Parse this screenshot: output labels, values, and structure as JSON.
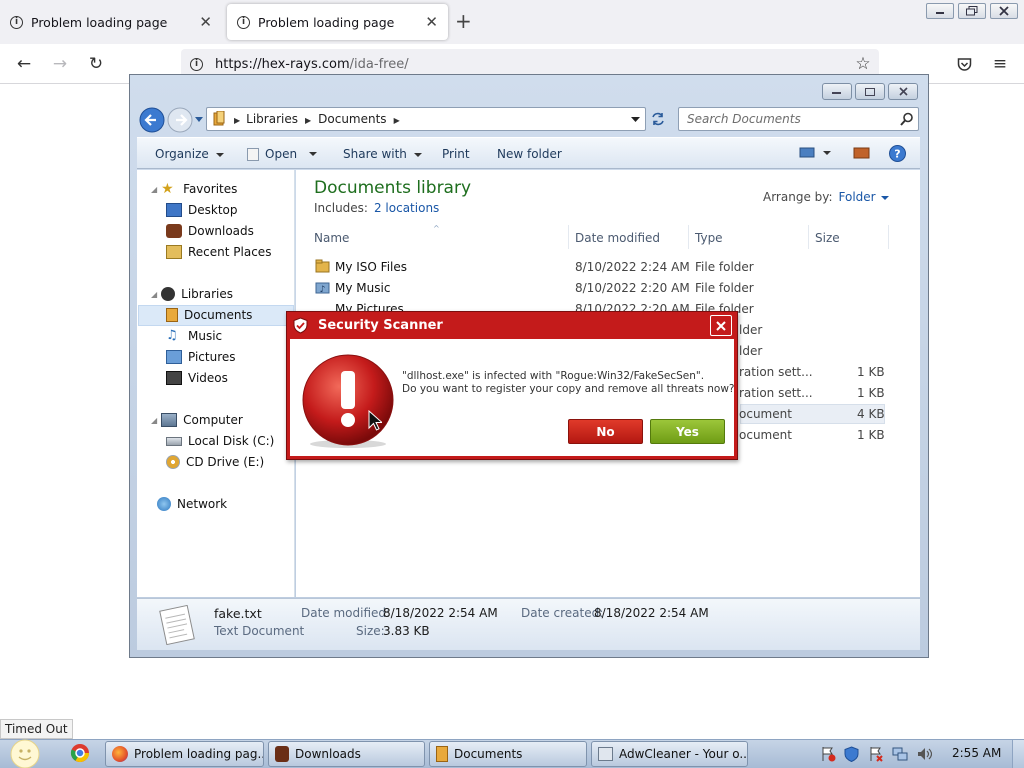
{
  "browser": {
    "tabs": [
      {
        "title": "Problem loading page"
      },
      {
        "title": "Problem loading page"
      }
    ],
    "url_host": "https://hex-rays.com",
    "url_path": "/ida-free/",
    "status_text": "Timed Out"
  },
  "explorer": {
    "breadcrumb": [
      "Libraries",
      "Documents"
    ],
    "search_placeholder": "Search Documents",
    "toolbar": {
      "organize": "Organize",
      "open": "Open",
      "share_with": "Share with",
      "print": "Print",
      "new_folder": "New folder"
    },
    "nav": {
      "favorites": "Favorites",
      "favorites_items": [
        "Desktop",
        "Downloads",
        "Recent Places"
      ],
      "libraries": "Libraries",
      "libraries_items": [
        "Documents",
        "Music",
        "Pictures",
        "Videos"
      ],
      "computer": "Computer",
      "computer_items": [
        "Local Disk (C:)",
        "CD Drive (E:)"
      ],
      "network": "Network"
    },
    "library": {
      "title": "Documents library",
      "includes_label": "Includes:",
      "includes_link": "2 locations",
      "arrange_label": "Arrange by:",
      "arrange_value": "Folder"
    },
    "columns": {
      "name": "Name",
      "date": "Date modified",
      "type": "Type",
      "size": "Size"
    },
    "files": [
      {
        "name": "My ISO Files",
        "date": "8/10/2022 2:24 AM",
        "type": "File folder",
        "size": ""
      },
      {
        "name": "My Music",
        "date": "8/10/2022 2:20 AM",
        "type": "File folder",
        "size": ""
      },
      {
        "name": "My Pictures",
        "date": "8/10/2022 2:20 AM",
        "type": "File folder",
        "size": ""
      },
      {
        "name": "",
        "date": "",
        "type": "lder",
        "size": ""
      },
      {
        "name": "",
        "date": "",
        "type": "lder",
        "size": ""
      },
      {
        "name": "",
        "date": "",
        "type": "ration sett...",
        "size": "1 KB"
      },
      {
        "name": "",
        "date": "",
        "type": "ration sett...",
        "size": "1 KB"
      },
      {
        "name": "",
        "date": "",
        "type": "ocument",
        "size": "4 KB"
      },
      {
        "name": "",
        "date": "",
        "type": "ocument",
        "size": "1 KB"
      }
    ],
    "details": {
      "file_name": "fake.txt",
      "file_type": "Text Document",
      "modified_label": "Date modified:",
      "modified_value": "8/18/2022 2:54 AM",
      "created_label": "Date created:",
      "created_value": "8/18/2022 2:54 AM",
      "size_label": "Size:",
      "size_value": "3.83 KB"
    }
  },
  "dialog": {
    "title": "Security Scanner",
    "message_line1": "\"dllhost.exe\" is infected with \"Rogue:Win32/FakeSecSen\".",
    "message_line2": "Do you want to register your copy and remove all threats now?",
    "no_label": "No",
    "yes_label": "Yes"
  },
  "taskbar": {
    "buttons": [
      "Problem loading pag...",
      "Downloads",
      "Documents",
      "AdwCleaner - Your o..."
    ],
    "clock": "2:55 AM"
  },
  "colors": {
    "dialog_red": "#c41b1b",
    "yes_green": "#8ab52a",
    "no_red": "#d42a1d",
    "library_title_green": "#1e6e1e",
    "link_blue": "#1a57a7"
  }
}
